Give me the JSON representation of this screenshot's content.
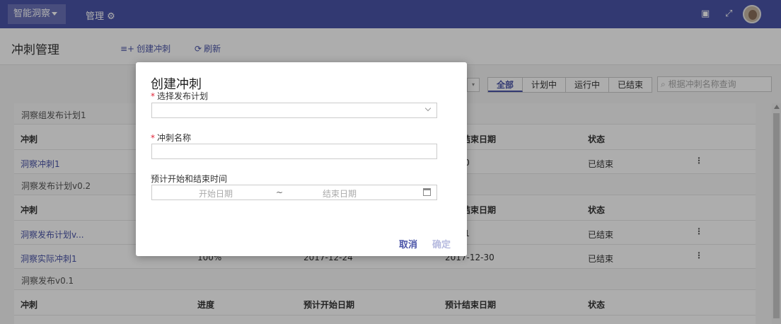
{
  "topbar": {
    "app_name": "智能洞察",
    "manage_label": "管理",
    "icons": [
      "gear-icon",
      "mobile-icon",
      "fullscreen-icon",
      "avatar"
    ]
  },
  "header": {
    "title": "冲刺管理",
    "create_label": "创建冲刺",
    "refresh_label": "刷新"
  },
  "filters": {
    "tabs": [
      "全部",
      "计划中",
      "运行中",
      "已结束"
    ],
    "active_tab": "全部",
    "search_placeholder": "根据冲刺名称查询"
  },
  "list": {
    "columns": [
      "冲刺",
      "进度",
      "预计开始日期",
      "预计结束日期",
      "状态"
    ],
    "groups": [
      {
        "name": "洞察组发布计划1",
        "rows": [
          {
            "name": "洞察冲刺1",
            "end_date": "01-30",
            "status": "已结束"
          }
        ]
      },
      {
        "name": "洞察发布计划v0.2",
        "rows": [
          {
            "name": "洞察发布计划v...",
            "end_date": "01-31",
            "status": "已结束"
          },
          {
            "name": "洞察实际冲刺1",
            "progress": "100%",
            "start_date": "2017-12-24",
            "end_date": "2017-12-30",
            "status": "已结束"
          }
        ]
      },
      {
        "name": "洞察发布v0.1",
        "rows": []
      }
    ]
  },
  "modal": {
    "title": "创建冲刺",
    "plan_label": "选择发布计划",
    "name_label": "冲刺名称",
    "time_label": "预计开始和结束时间",
    "start_placeholder": "开始日期",
    "separator": "~",
    "end_placeholder": "结束日期",
    "cancel_label": "取消",
    "ok_label": "确定",
    "required_mark": "*"
  },
  "colors": {
    "brand": "#4b55a8",
    "required": "#e0263a"
  }
}
